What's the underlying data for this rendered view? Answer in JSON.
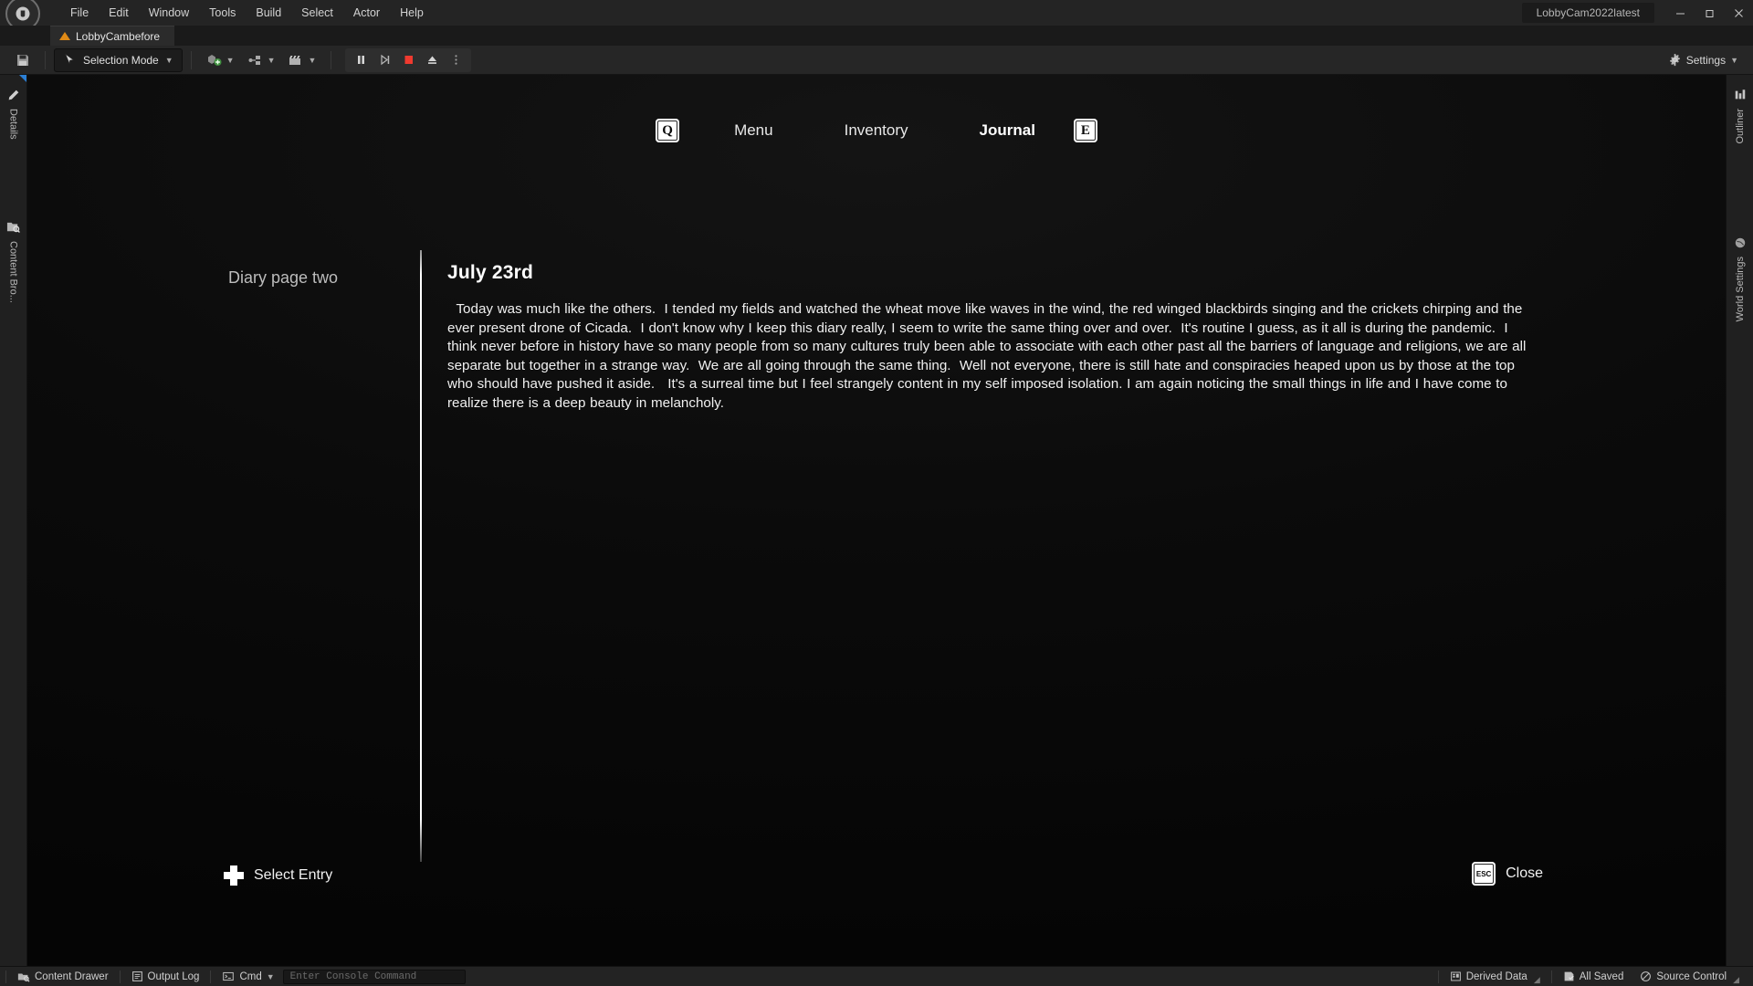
{
  "window": {
    "project_title": "LobbyCam2022latest",
    "minimize_label": "—",
    "maximize_label": "❐",
    "close_label": "✕",
    "logo_glyph": "Ⓤ"
  },
  "menubar": {
    "items": [
      {
        "label": "File"
      },
      {
        "label": "Edit"
      },
      {
        "label": "Window"
      },
      {
        "label": "Tools"
      },
      {
        "label": "Build"
      },
      {
        "label": "Select"
      },
      {
        "label": "Actor"
      },
      {
        "label": "Help"
      }
    ]
  },
  "level_tab": {
    "label": "LobbyCambefore"
  },
  "toolbar": {
    "save_icon": "save-icon",
    "mode_label": "Selection Mode",
    "add_label": "add-actor-button",
    "blueprint_label": "blueprints-button",
    "cinematics_label": "cinematics-button",
    "playback": {
      "pause_label": "Pause",
      "step_label": "Skip / Frame Step",
      "stop_label": "Stop",
      "eject_label": "Eject",
      "more_label": "More play options"
    },
    "settings_label": "Settings"
  },
  "left_rail": {
    "items": [
      {
        "label": "Details",
        "icon": "details-pencil-icon"
      },
      {
        "label": "Content Bro...",
        "icon": "content-browser-icon"
      }
    ]
  },
  "right_rail": {
    "items": [
      {
        "label": "Outliner",
        "icon": "outliner-icon"
      },
      {
        "label": "World Settings",
        "icon": "world-settings-icon"
      }
    ]
  },
  "game_hud": {
    "nav": {
      "prev_key": "Q",
      "next_key": "E",
      "tabs": [
        {
          "label": "Menu",
          "active": false
        },
        {
          "label": "Inventory",
          "active": false
        },
        {
          "label": "Journal",
          "active": true
        }
      ]
    },
    "entries": [
      {
        "label": "Diary page two",
        "selected": true
      }
    ],
    "page": {
      "title": "July  23rd",
      "body": "  Today was much like the others.  I tended my fields and watched the wheat move like waves in the wind, the red winged blackbirds singing and the crickets chirping and the ever present drone of Cicada.  I don't know why I keep this diary really, I seem to write the same thing over and over.  It's routine I guess, as it all is during the pandemic.  I think never before in history have so many people from so many cultures truly been able to associate with each other past all the barriers of language and religions, we are all separate but together in a strange way.  We are all going through the same thing.  Well not everyone, there is still hate and conspiracies heaped upon us by those at the top who should have pushed it aside.   It's a surreal time but I feel strangely content in my self imposed isolation. I am again noticing the small things in life and I have come to realize there is a deep beauty in melancholy."
    },
    "actions": {
      "select_label": "Select Entry",
      "select_icon": "dpad-icon",
      "close_key": "ESC",
      "close_label": "Close"
    }
  },
  "statusbar": {
    "left": [
      {
        "label": "Content Drawer",
        "icon": "content-drawer-icon"
      },
      {
        "label": "Output Log",
        "icon": "output-log-icon"
      },
      {
        "label": "Cmd",
        "icon": "cmd-icon"
      }
    ],
    "console_placeholder": "Enter Console Command",
    "right": [
      {
        "label": "Derived Data",
        "icon": "derived-data-icon"
      },
      {
        "label": "All Saved",
        "icon": "all-saved-icon"
      },
      {
        "label": "Source Control",
        "icon": "source-control-icon"
      }
    ]
  },
  "colors": {
    "accent_orange": "#e08a16",
    "stop_red": "#f03a2f",
    "add_green": "#4caf50",
    "chrome": "#262626"
  }
}
